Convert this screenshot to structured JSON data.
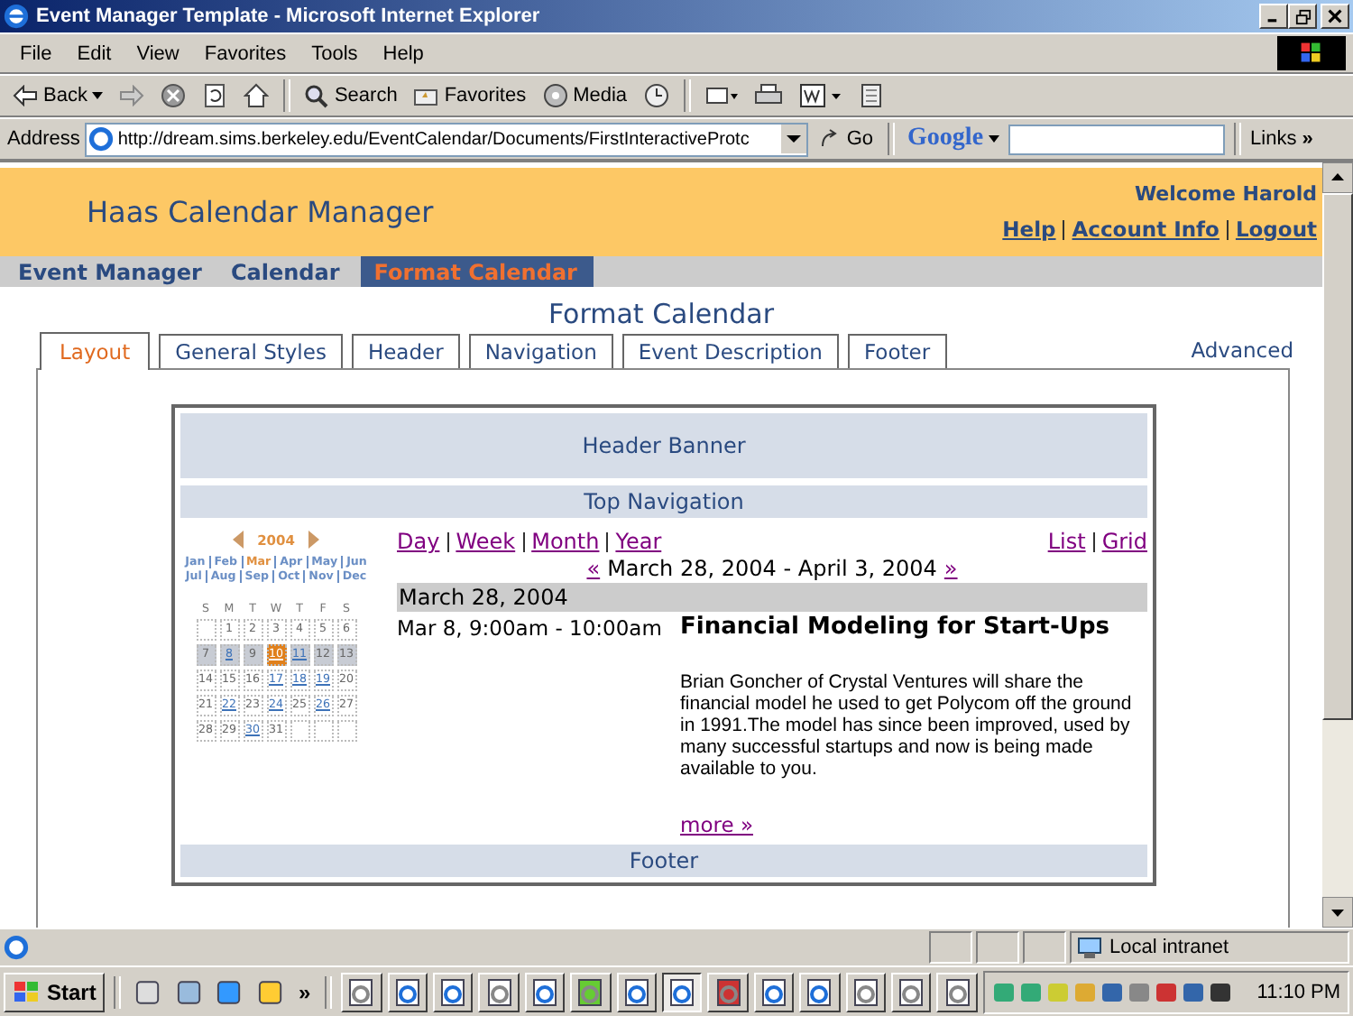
{
  "window": {
    "title": "Event Manager Template - Microsoft Internet Explorer"
  },
  "menu": [
    "File",
    "Edit",
    "View",
    "Favorites",
    "Tools",
    "Help"
  ],
  "toolbar": {
    "back": "Back",
    "search": "Search",
    "favorites": "Favorites",
    "media": "Media"
  },
  "address_bar": {
    "label": "Address",
    "url": "http://dream.sims.berkeley.edu/EventCalendar/Documents/FirstInteractiveProtc",
    "go": "Go",
    "google": "Google",
    "links": "Links",
    "more": "»"
  },
  "page": {
    "site_title": "Haas Calendar Manager",
    "welcome": "Welcome Harold",
    "user_links": [
      "Help",
      "Account Info",
      "Logout"
    ],
    "nav": [
      {
        "label": "Event Manager",
        "selected": false
      },
      {
        "label": "Calendar",
        "selected": false
      },
      {
        "label": "Format Calendar",
        "selected": true
      }
    ],
    "heading": "Format Calendar",
    "tabs": [
      {
        "label": "Layout",
        "selected": true
      },
      {
        "label": "General Styles",
        "selected": false
      },
      {
        "label": "Header",
        "selected": false
      },
      {
        "label": "Navigation",
        "selected": false
      },
      {
        "label": "Event Description",
        "selected": false
      },
      {
        "label": "Footer",
        "selected": false
      }
    ],
    "advanced": "Advanced",
    "preview": {
      "header_banner": "Header Banner",
      "top_navigation": "Top Navigation",
      "mini_calendar": {
        "year": "2004",
        "months": [
          {
            "label": "Jan",
            "selected": false
          },
          {
            "label": "Feb",
            "selected": false
          },
          {
            "label": "Mar",
            "selected": true
          },
          {
            "label": "Apr",
            "selected": false
          },
          {
            "label": "May",
            "selected": false
          },
          {
            "label": "Jun",
            "selected": false
          },
          {
            "label": "Jul",
            "selected": false
          },
          {
            "label": "Aug",
            "selected": false
          },
          {
            "label": "Sep",
            "selected": false
          },
          {
            "label": "Oct",
            "selected": false
          },
          {
            "label": "Nov",
            "selected": false
          },
          {
            "label": "Dec",
            "selected": false
          }
        ],
        "weekdays": [
          "S",
          "M",
          "T",
          "W",
          "T",
          "F",
          "S"
        ],
        "weeks": [
          {
            "current": false,
            "days": [
              {
                "kind": "blank"
              },
              {
                "kind": "day",
                "label": "1",
                "linked": false,
                "selected": false
              },
              {
                "kind": "day",
                "label": "2",
                "linked": false,
                "selected": false
              },
              {
                "kind": "day",
                "label": "3",
                "linked": false,
                "selected": false
              },
              {
                "kind": "day",
                "label": "4",
                "linked": false,
                "selected": false
              },
              {
                "kind": "day",
                "label": "5",
                "linked": false,
                "selected": false
              },
              {
                "kind": "day",
                "label": "6",
                "linked": false,
                "selected": false
              }
            ]
          },
          {
            "current": true,
            "days": [
              {
                "kind": "day",
                "label": "7",
                "linked": false,
                "selected": false
              },
              {
                "kind": "day",
                "label": "8",
                "linked": true,
                "selected": false
              },
              {
                "kind": "day",
                "label": "9",
                "linked": false,
                "selected": false
              },
              {
                "kind": "day",
                "label": "10",
                "linked": true,
                "selected": true
              },
              {
                "kind": "day",
                "label": "11",
                "linked": true,
                "selected": false
              },
              {
                "kind": "day",
                "label": "12",
                "linked": false,
                "selected": false
              },
              {
                "kind": "day",
                "label": "13",
                "linked": false,
                "selected": false
              }
            ]
          },
          {
            "current": false,
            "days": [
              {
                "kind": "day",
                "label": "14",
                "linked": false,
                "selected": false
              },
              {
                "kind": "day",
                "label": "15",
                "linked": false,
                "selected": false
              },
              {
                "kind": "day",
                "label": "16",
                "linked": false,
                "selected": false
              },
              {
                "kind": "day",
                "label": "17",
                "linked": true,
                "selected": false
              },
              {
                "kind": "day",
                "label": "18",
                "linked": true,
                "selected": false
              },
              {
                "kind": "day",
                "label": "19",
                "linked": true,
                "selected": false
              },
              {
                "kind": "day",
                "label": "20",
                "linked": false,
                "selected": false
              }
            ]
          },
          {
            "current": false,
            "days": [
              {
                "kind": "day",
                "label": "21",
                "linked": false,
                "selected": false
              },
              {
                "kind": "day",
                "label": "22",
                "linked": true,
                "selected": false
              },
              {
                "kind": "day",
                "label": "23",
                "linked": false,
                "selected": false
              },
              {
                "kind": "day",
                "label": "24",
                "linked": true,
                "selected": false
              },
              {
                "kind": "day",
                "label": "25",
                "linked": false,
                "selected": false
              },
              {
                "kind": "day",
                "label": "26",
                "linked": true,
                "selected": false
              },
              {
                "kind": "day",
                "label": "27",
                "linked": false,
                "selected": false
              }
            ]
          },
          {
            "current": false,
            "days": [
              {
                "kind": "day",
                "label": "28",
                "linked": false,
                "selected": false
              },
              {
                "kind": "day",
                "label": "29",
                "linked": false,
                "selected": false
              },
              {
                "kind": "day",
                "label": "30",
                "linked": true,
                "selected": false
              },
              {
                "kind": "day",
                "label": "31",
                "linked": false,
                "selected": false
              },
              {
                "kind": "blank"
              },
              {
                "kind": "blank"
              },
              {
                "kind": "blank"
              }
            ]
          }
        ]
      },
      "view_links": [
        "Day",
        "Week",
        "Month",
        "Year"
      ],
      "layout_links": [
        "List",
        "Grid"
      ],
      "previous": "«",
      "range": "March 28, 2004 - April 3, 2004",
      "next": "»",
      "date_header": "March 28, 2004",
      "event": {
        "time": "Mar 8, 9:00am - 10:00am",
        "title": "Financial Modeling for Start-Ups",
        "description": "Brian Goncher of Crystal Ventures will share the financial model he used to get Polycom off the ground in 1991.The model has since been improved, used by many successful startups and now is being made available to you.",
        "more": "more »"
      },
      "footer": "Footer"
    }
  },
  "status_bar": {
    "zone": "Local intranet"
  },
  "taskbar": {
    "start": "Start",
    "more": "»",
    "clock": "11:10 PM"
  }
}
